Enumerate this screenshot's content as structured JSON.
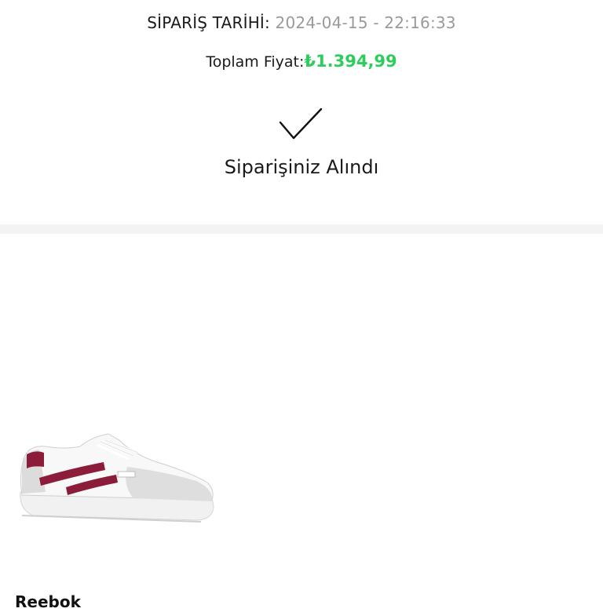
{
  "order": {
    "date_label": "SİPARİŞ TARİHİ:",
    "date_value": "2024-04-15 - 22:16:33",
    "total_label": "Toplam Fiyat:",
    "total_value": "₺1.394,99",
    "status": "Siparişiniz Alındı"
  },
  "product": {
    "brand": "Reebok",
    "image_icon": "sneaker-image"
  },
  "colors": {
    "price": "#2ecc5c",
    "date_value": "#9a9a9a",
    "divider": "#f3f3f3",
    "accent_burgundy": "#8b1c3a"
  }
}
